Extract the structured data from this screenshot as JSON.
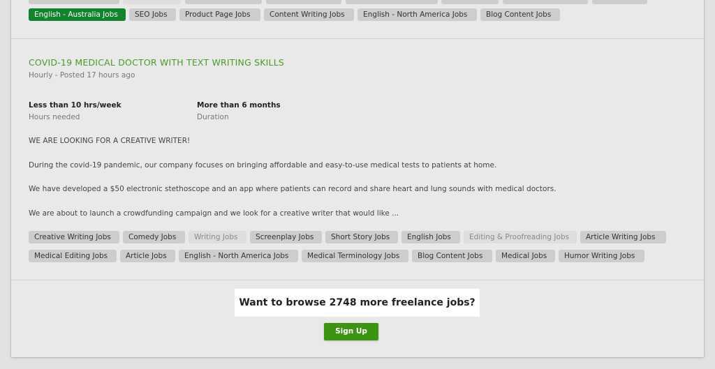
{
  "previous_job": {
    "tags": [
      {
        "label": "English - Australia Jobs",
        "style": "highlight"
      },
      {
        "label": "SEO Jobs",
        "style": "normal"
      },
      {
        "label": "Product Page Jobs",
        "style": "normal"
      },
      {
        "label": "Content Writing Jobs",
        "style": "normal"
      },
      {
        "label": "English - North America Jobs",
        "style": "normal"
      },
      {
        "label": "Blog Content Jobs",
        "style": "normal"
      }
    ]
  },
  "job": {
    "title": "COVID-19 MEDICAL DOCTOR WITH TEXT WRITING SKILLS",
    "meta": "Hourly - Posted 17 hours ago",
    "hours": {
      "value": "Less than 10 hrs/week",
      "label": "Hours needed"
    },
    "duration": {
      "value": "More than 6 months",
      "label": "Duration"
    },
    "description": [
      "WE ARE LOOKING FOR A CREATIVE WRITER!",
      "During the covid-19 pandemic, our company focuses on bringing affordable and easy-to-use medical tests to patients at home.",
      "We have developed a $50 electronic stethoscope and an app where patients can record and share heart and lung sounds with medical doctors.",
      "We are about to launch a crowdfunding campaign and we look for a creative writer that would like ..."
    ],
    "tags": [
      {
        "label": "Creative Writing Jobs",
        "style": "normal"
      },
      {
        "label": "Comedy Jobs",
        "style": "normal"
      },
      {
        "label": "Writing Jobs",
        "style": "light"
      },
      {
        "label": "Screenplay Jobs",
        "style": "normal"
      },
      {
        "label": "Short Story Jobs",
        "style": "normal"
      },
      {
        "label": "English Jobs",
        "style": "normal"
      },
      {
        "label": "Editing & Proofreading Jobs",
        "style": "light"
      },
      {
        "label": "Article Writing Jobs",
        "style": "normal"
      },
      {
        "label": "Medical Editing Jobs",
        "style": "normal"
      },
      {
        "label": "Article Jobs",
        "style": "normal"
      },
      {
        "label": "English - North America Jobs",
        "style": "normal"
      },
      {
        "label": "Medical Terminology Jobs",
        "style": "normal"
      },
      {
        "label": "Blog Content Jobs",
        "style": "normal"
      },
      {
        "label": "Medical Jobs",
        "style": "normal"
      },
      {
        "label": "Humor Writing Jobs",
        "style": "normal"
      }
    ]
  },
  "cta": {
    "text": "Want to browse 2748 more freelance jobs?",
    "button_label": "Sign Up"
  },
  "colors": {
    "title_green": "#4a9c26",
    "highlight_tag": "#14832d",
    "signup_green": "#3b9412"
  }
}
